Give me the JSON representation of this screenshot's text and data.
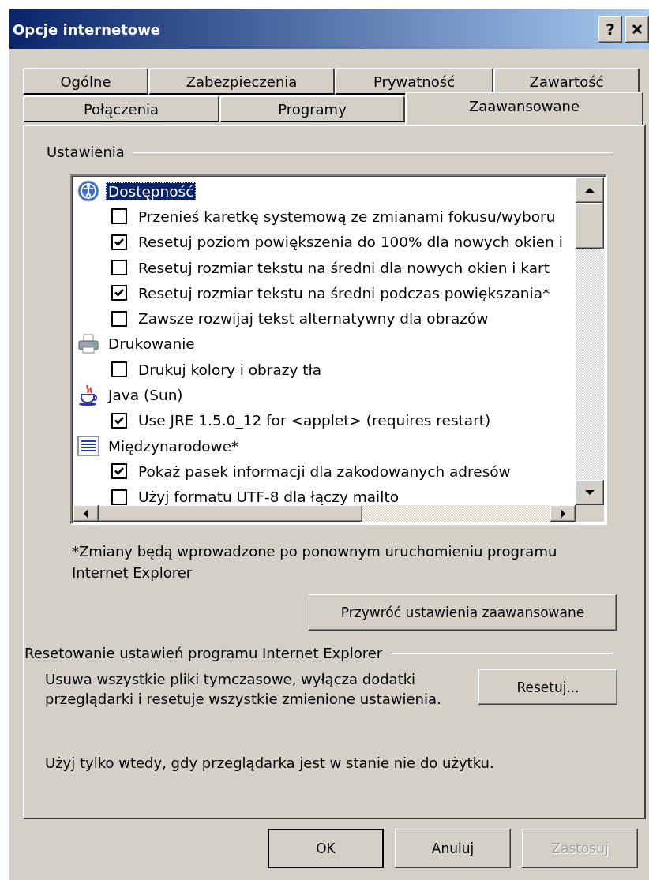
{
  "window": {
    "title": "Opcje internetowe",
    "buttons": [
      {
        "kind": "help",
        "label": "?"
      },
      {
        "kind": "close"
      }
    ]
  },
  "tab_rows": [
    {
      "tabs": [
        {
          "label": "Ogólne",
          "selected": false
        },
        {
          "label": "Zabezpieczenia",
          "selected": false
        },
        {
          "label": "Prywatność",
          "selected": false
        },
        {
          "label": "Zawartość",
          "selected": false
        }
      ]
    },
    {
      "tabs": [
        {
          "label": "Połączenia",
          "selected": false
        },
        {
          "label": "Programy",
          "selected": false
        },
        {
          "label": "Zaawansowane",
          "selected": true
        }
      ]
    }
  ],
  "settings": {
    "legend": "Ustawienia",
    "tree": [
      {
        "label": "Dostępność",
        "kind": "accessibility",
        "selected": true,
        "children": [
          {
            "label": "Przenieś karetkę systemową ze zmianami fokusu/wyboru",
            "checked": false
          },
          {
            "label": "Resetuj poziom powiększenia do 100% dla nowych okien i",
            "checked": true
          },
          {
            "label": "Resetuj rozmiar tekstu na średni dla nowych okien i kart",
            "checked": false
          },
          {
            "label": "Resetuj rozmiar tekstu na średni podczas powiększania*",
            "checked": true
          },
          {
            "label": "Zawsze rozwijaj tekst alternatywny dla obrazów",
            "checked": false
          }
        ]
      },
      {
        "label": "Drukowanie",
        "kind": "printer",
        "selected": false,
        "children": [
          {
            "label": "Drukuj kolory i obrazy tła",
            "checked": false
          }
        ]
      },
      {
        "label": "Java (Sun)",
        "kind": "java",
        "selected": false,
        "children": [
          {
            "label": "Use JRE 1.5.0_12 for <applet> (requires restart)",
            "checked": true
          }
        ]
      },
      {
        "label": "Międzynarodowe*",
        "kind": "document",
        "selected": false,
        "children": [
          {
            "label": "Pokaż pasek informacji dla zakodowanych adresów",
            "checked": true
          },
          {
            "label": "Użyj formatu UTF-8 dla łączy mailto",
            "checked": false
          }
        ]
      }
    ]
  },
  "note": "*Zmiany będą wprowadzone po ponownym uruchomieniu programu Internet Explorer",
  "restore_button": "Przywróć ustawienia zaawansowane",
  "reset_section": {
    "legend": "Resetowanie ustawień programu Internet Explorer",
    "description": "Usuwa wszystkie pliki tymczasowe, wyłącza dodatki przeglądarki i resetuje wszystkie zmienione ustawienia.",
    "button": "Resetuj...",
    "hint": "Użyj tylko wtedy, gdy przeglądarka jest w stanie nie do użytku."
  },
  "footer_buttons": [
    {
      "label": "OK",
      "default": true,
      "disabled": false
    },
    {
      "label": "Anuluj",
      "default": false,
      "disabled": false
    },
    {
      "label": "Zastosuj",
      "default": false,
      "disabled": true
    }
  ]
}
